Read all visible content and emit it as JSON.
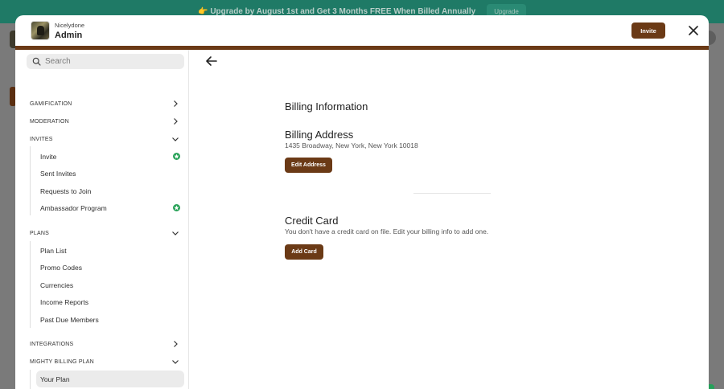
{
  "banner": {
    "text": "👉 Upgrade by August 1st and Get 3 Months FREE When Billed Annually",
    "button_label": "Upgrade"
  },
  "header": {
    "community_name": "Nicelydone",
    "title": "Admin",
    "invite_label": "Invite"
  },
  "search": {
    "placeholder": "Search",
    "value": ""
  },
  "sidebar": {
    "sections": [
      {
        "label": "GAMIFICATION",
        "expanded": false
      },
      {
        "label": "MODERATION",
        "expanded": false
      },
      {
        "label": "INVITES",
        "expanded": true,
        "items": [
          {
            "label": "Invite",
            "badge": "star"
          },
          {
            "label": "Sent Invites"
          },
          {
            "label": "Requests to Join"
          },
          {
            "label": "Ambassador Program",
            "badge": "star"
          }
        ]
      },
      {
        "label": "PLANS",
        "expanded": true,
        "items": [
          {
            "label": "Plan List"
          },
          {
            "label": "Promo Codes"
          },
          {
            "label": "Currencies"
          },
          {
            "label": "Income Reports"
          },
          {
            "label": "Past Due Members"
          }
        ]
      },
      {
        "label": "INTEGRATIONS",
        "expanded": false
      },
      {
        "label": "MIGHTY BILLING PLAN",
        "expanded": true,
        "items": [
          {
            "label": "Your Plan",
            "active": true
          }
        ]
      }
    ]
  },
  "main": {
    "title": "Billing Information",
    "address": {
      "heading": "Billing Address",
      "text": "1435 Broadway, New York, New York 10018",
      "button_label": "Edit Address"
    },
    "card": {
      "heading": "Credit Card",
      "text": "You don't have a credit card on file. Edit your billing info to add one.",
      "button_label": "Add Card"
    }
  },
  "colors": {
    "brand": "#6b3a16",
    "banner": "#1f7a66",
    "badge_green": "#2ba35a",
    "active_item_bg": "#ebebeb"
  },
  "icons": [
    "search-icon",
    "arrow-left-icon",
    "close-icon",
    "chevron-right-icon",
    "chevron-down-icon",
    "star-badge-icon"
  ]
}
